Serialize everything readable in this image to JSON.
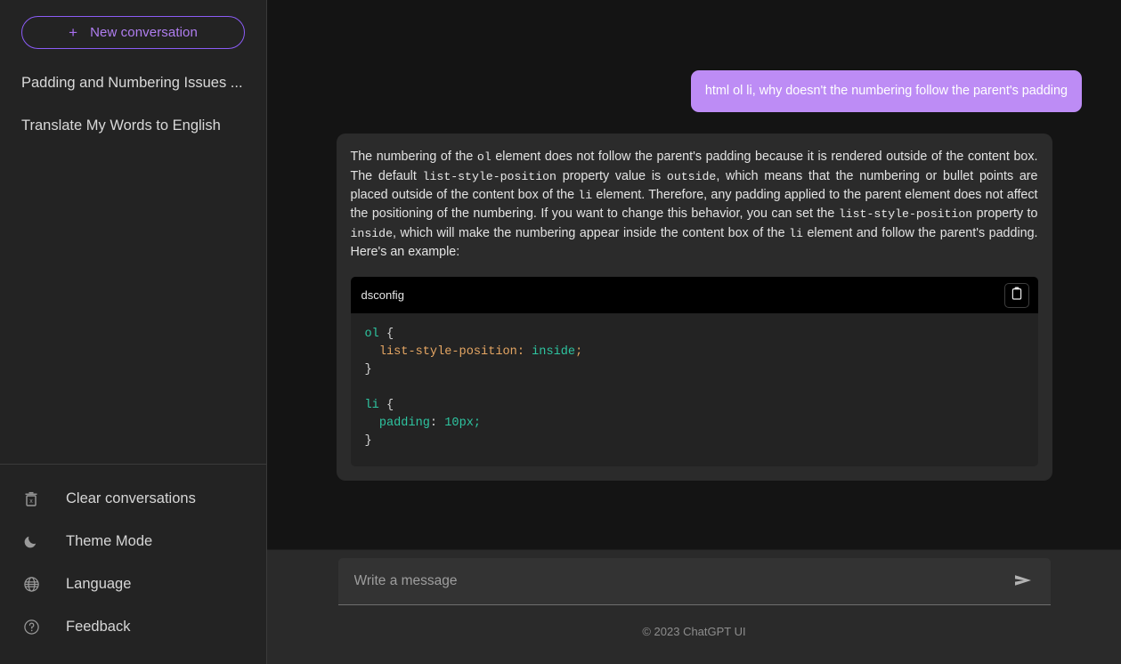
{
  "sidebar": {
    "new_conversation": {
      "icon": "plus-icon",
      "label": "New conversation"
    },
    "conversations": [
      {
        "title": "Padding and Numbering Issues ..."
      },
      {
        "title": "Translate My Words to English"
      }
    ],
    "footer_items": [
      {
        "icon": "trash-delete-icon",
        "label": "Clear conversations"
      },
      {
        "icon": "moon-icon",
        "label": "Theme Mode"
      },
      {
        "icon": "globe-icon",
        "label": "Language"
      },
      {
        "icon": "question-circle-icon",
        "label": "Feedback"
      }
    ]
  },
  "chat": {
    "user_message": "html ol li, why doesn't the numbering follow the parent's padding",
    "assistant_message": {
      "p1_a": "The numbering of the ",
      "p1_code1": "ol",
      "p1_b": " element does not follow the parent's padding because it is rendered outside of the content box. The default ",
      "p1_code2": "list-style-position",
      "p1_c": " property value is ",
      "p1_code3": "outside",
      "p1_d": ", which means that the numbering or bullet points are placed outside of the content box of the ",
      "p1_code4": "li",
      "p1_e": " element. Therefore, any padding applied to the parent element does not affect the positioning of the numbering. If you want to change this behavior, you can set the ",
      "p1_code5": "list-style-position",
      "p1_f": " property to ",
      "p1_code6": "inside",
      "p1_g": ", which will make the numbering appear inside the content box of the ",
      "p1_code7": "li",
      "p1_h": " element and follow the parent's padding. Here's an example:"
    },
    "code_block": {
      "language": "dsconfig",
      "copy_icon": "clipboard-copy-icon",
      "lines": {
        "l1_sel": "ol",
        "l1_brace": " {",
        "l2_prop": "  list-style-position",
        "l2_colon": ": ",
        "l2_val": "inside",
        "l2_semi": ";",
        "l3_brace": "}",
        "l5_sel": "li",
        "l5_brace": " {",
        "l6_prop": "  padding",
        "l6_colon": ": ",
        "l6_val": "10px",
        "l6_semi": ";",
        "l7_brace": "}"
      }
    }
  },
  "composer": {
    "placeholder": "Write a message",
    "value": "",
    "send_icon": "send-arrow-icon"
  },
  "footer": {
    "copyright": "© 2023 ChatGPT UI"
  },
  "colors": {
    "accent_purple": "#8b5cf6",
    "user_bubble": "#bd8cf5",
    "page_bg": "#141414",
    "sidebar_bg": "#232323",
    "card_bg": "#2b2b2b",
    "code_bg": "#232323",
    "code_head_bg": "#000000",
    "syntax_selector": "#2ec4a0",
    "syntax_property": "#e5a663",
    "syntax_value": "#2ec4a0"
  }
}
